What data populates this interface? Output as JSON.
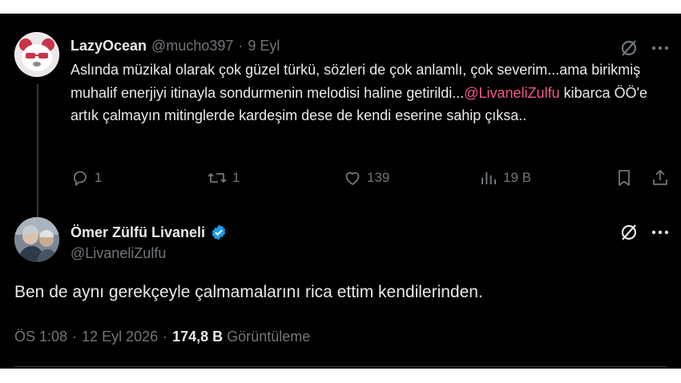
{
  "reply": {
    "display_name": "LazyOcean",
    "handle": "@mucho397",
    "separator": "·",
    "time": "9 Eyl",
    "text_part1": "Aslında müzikal olarak çok güzel türkü, sözleri de çok anlamlı, çok severim...ama birikmiş muhalif enerjiyi itinayla sondurmenin melodisi haline getirildi...",
    "mention": "@LivaneliZulfu",
    "text_part2": " kibarca ÖÖ'e artık çalmayın mitinglerde kardeşim dese de kendi eserine sahip çıksa..",
    "stats": {
      "replies": "1",
      "reposts": "1",
      "likes": "139",
      "views": "19 B"
    }
  },
  "main": {
    "display_name": "Ömer Zülfü Livaneli",
    "handle": "@LivaneliZulfu",
    "text": "Ben de aynı gerekçeyle çalmamalarını rica ettim kendilerinden.",
    "time": "ÖS 1:08",
    "date": "12 Eyl 2026",
    "separator": "·",
    "views_count": "174,8 B",
    "views_label": "Görüntüleme"
  },
  "colors": {
    "background": "#000000",
    "text": "#e7e9ea",
    "muted": "#71767b",
    "mention": "#f5578e",
    "verified": "#1d9bf0"
  },
  "icons": [
    "grok-icon",
    "more-icon",
    "reply-icon",
    "repost-icon",
    "like-icon",
    "views-icon",
    "bookmark-icon",
    "share-icon",
    "verified-badge-icon"
  ]
}
